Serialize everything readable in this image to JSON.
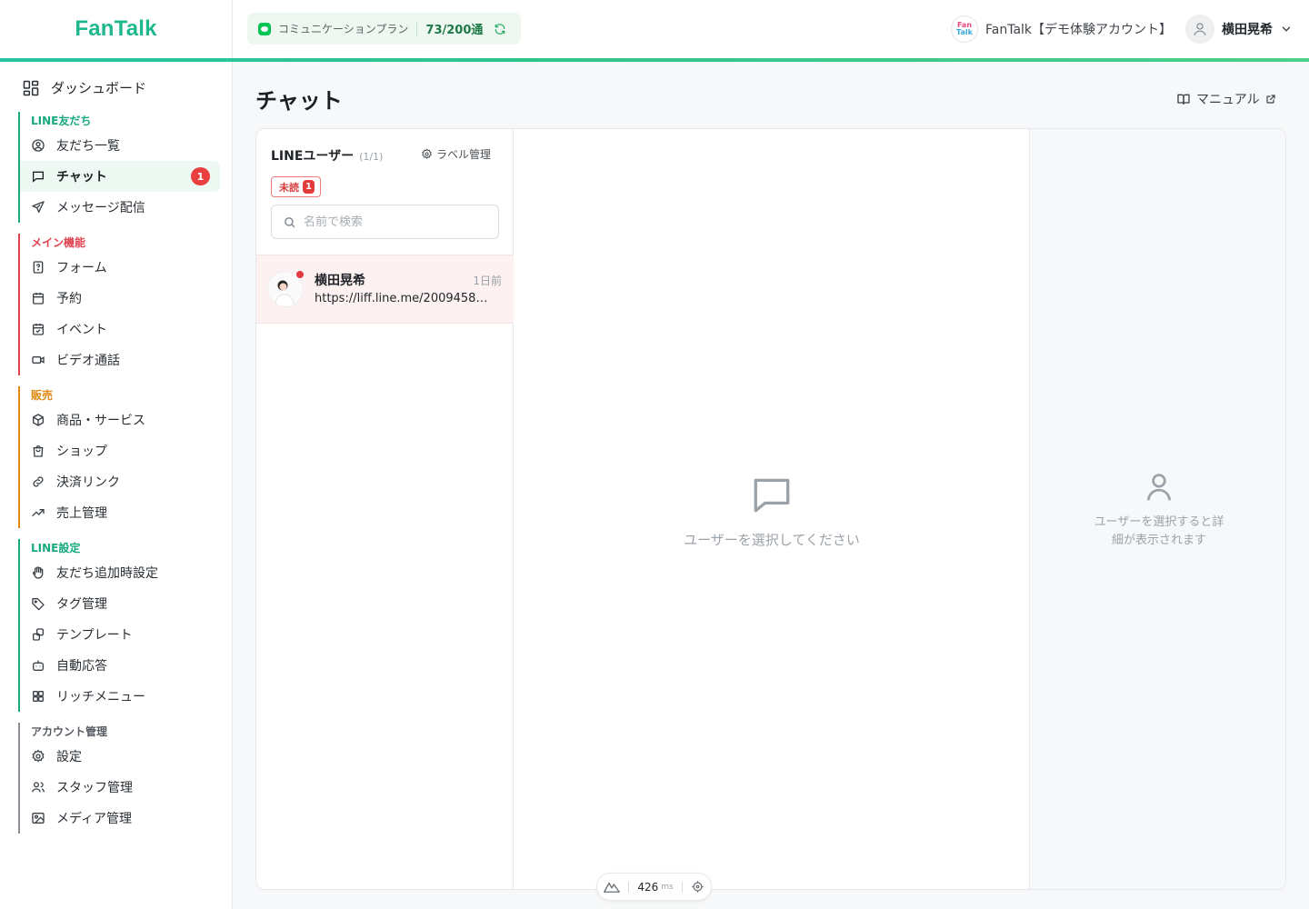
{
  "brand": {
    "logo": "FanTalk",
    "accent": "#1fb88e"
  },
  "header": {
    "plan_name": "コミュニケーションプラン",
    "plan_usage": "73/200通",
    "account_logo_text_top": "Fan",
    "account_logo_text_bottom": "Talk",
    "account_name": "FanTalk【デモ体験アカウント】",
    "user_name": "横田晃希"
  },
  "sidebar": {
    "dashboard": "ダッシュボード",
    "groups": [
      {
        "title": "LINE友だち",
        "color": "#18a97f",
        "items": [
          {
            "label": "友だち一覧",
            "icon": "user-circle-icon"
          },
          {
            "label": "チャット",
            "icon": "chat-icon",
            "active": true,
            "badge": "1"
          },
          {
            "label": "メッセージ配信",
            "icon": "send-icon"
          }
        ]
      },
      {
        "title": "メイン機能",
        "color": "#e0424e",
        "items": [
          {
            "label": "フォーム",
            "icon": "form-icon"
          },
          {
            "label": "予約",
            "icon": "calendar-icon"
          },
          {
            "label": "イベント",
            "icon": "calendar-check-icon"
          },
          {
            "label": "ビデオ通話",
            "icon": "video-icon"
          }
        ]
      },
      {
        "title": "販売",
        "color": "#e08a12",
        "items": [
          {
            "label": "商品・サービス",
            "icon": "box-icon"
          },
          {
            "label": "ショップ",
            "icon": "shopping-bag-icon"
          },
          {
            "label": "決済リンク",
            "icon": "link-icon"
          },
          {
            "label": "売上管理",
            "icon": "trend-icon"
          }
        ]
      },
      {
        "title": "LINE設定",
        "color": "#18a97f",
        "items": [
          {
            "label": "友だち追加時設定",
            "icon": "hand-icon"
          },
          {
            "label": "タグ管理",
            "icon": "tag-icon"
          },
          {
            "label": "テンプレート",
            "icon": "template-icon"
          },
          {
            "label": "自動応答",
            "icon": "bot-icon"
          },
          {
            "label": "リッチメニュー",
            "icon": "grid-icon"
          }
        ]
      },
      {
        "title": "アカウント管理",
        "color": "#555b61",
        "items": [
          {
            "label": "設定",
            "icon": "gear-icon"
          },
          {
            "label": "スタッフ管理",
            "icon": "users-icon"
          },
          {
            "label": "メディア管理",
            "icon": "image-icon"
          }
        ]
      }
    ]
  },
  "main": {
    "title": "チャット",
    "manual": "マニュアル",
    "list": {
      "title": "LINEユーザー",
      "count": "(1/1)",
      "label_manage": "ラベル管理",
      "unread_label": "未読",
      "unread_count": "1",
      "search_placeholder": "名前で検索",
      "conversations": [
        {
          "name": "横田晃希",
          "time": "1日前",
          "message": "https://liff.line.me/2009458…"
        }
      ]
    },
    "empty_chat": "ユーザーを選択してください",
    "empty_detail": "ユーザーを選択すると詳細が表示されます"
  },
  "devbar": {
    "ms_value": "426",
    "ms_unit": "ms"
  }
}
